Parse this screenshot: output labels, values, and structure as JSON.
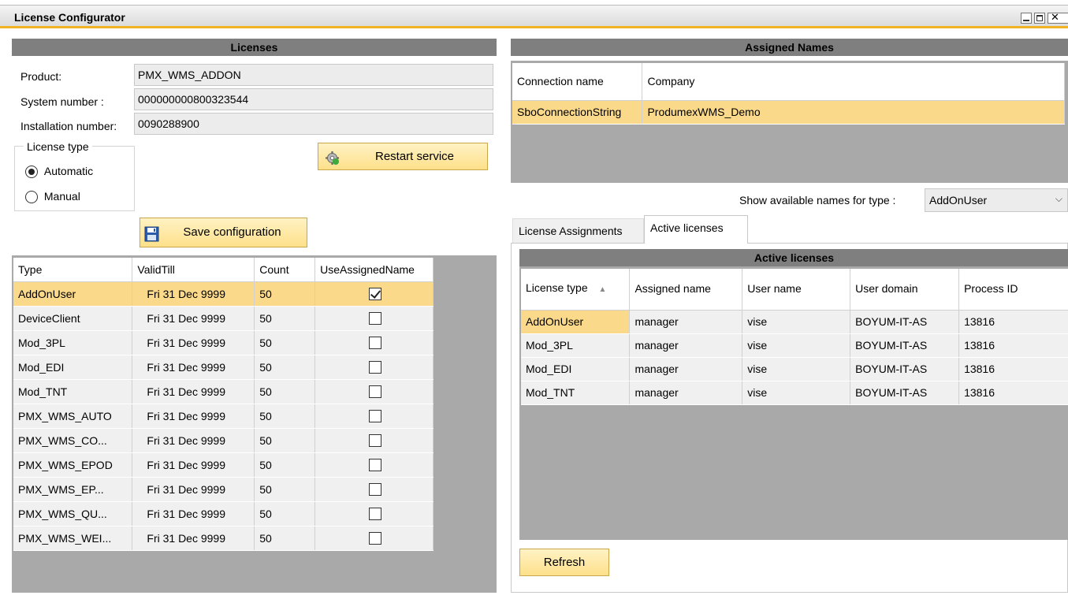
{
  "window": {
    "title": "License Configurator"
  },
  "licenses": {
    "header": "Licenses",
    "product_label": "Product:",
    "product_value": "PMX_WMS_ADDON",
    "system_number_label": "System number :",
    "system_number_value": "000000000800323544",
    "installation_number_label": "Installation number:",
    "installation_number_value": "0090288900",
    "license_type_legend": "License type",
    "license_type_options": [
      {
        "label": "Automatic",
        "selected": true
      },
      {
        "label": "Manual",
        "selected": false
      }
    ],
    "restart_service_label": "Restart service",
    "save_configuration_label": "Save configuration",
    "table": {
      "columns": [
        "Type",
        "ValidTill",
        "Count",
        "UseAssignedName"
      ],
      "rows": [
        {
          "type": "AddOnUser",
          "valid_till": "Fri 31 Dec 9999",
          "count": "50",
          "use_assigned_name": true,
          "selected": true
        },
        {
          "type": "DeviceClient",
          "valid_till": "Fri 31 Dec 9999",
          "count": "50",
          "use_assigned_name": false
        },
        {
          "type": "Mod_3PL",
          "valid_till": "Fri 31 Dec 9999",
          "count": "50",
          "use_assigned_name": false
        },
        {
          "type": "Mod_EDI",
          "valid_till": "Fri 31 Dec 9999",
          "count": "50",
          "use_assigned_name": false
        },
        {
          "type": "Mod_TNT",
          "valid_till": "Fri 31 Dec 9999",
          "count": "50",
          "use_assigned_name": false
        },
        {
          "type": "PMX_WMS_AUTO",
          "valid_till": "Fri 31 Dec 9999",
          "count": "50",
          "use_assigned_name": false
        },
        {
          "type": "PMX_WMS_CO...",
          "valid_till": "Fri 31 Dec 9999",
          "count": "50",
          "use_assigned_name": false
        },
        {
          "type": "PMX_WMS_EPOD",
          "valid_till": "Fri 31 Dec 9999",
          "count": "50",
          "use_assigned_name": false
        },
        {
          "type": "PMX_WMS_EP...",
          "valid_till": "Fri 31 Dec 9999",
          "count": "50",
          "use_assigned_name": false
        },
        {
          "type": "PMX_WMS_QU...",
          "valid_till": "Fri 31 Dec 9999",
          "count": "50",
          "use_assigned_name": false
        },
        {
          "type": "PMX_WMS_WEI...",
          "valid_till": "Fri 31 Dec 9999",
          "count": "50",
          "use_assigned_name": false
        }
      ]
    }
  },
  "assigned_names": {
    "header": "Assigned Names",
    "columns": [
      "Connection name",
      "Company"
    ],
    "rows": [
      {
        "connection_name": "SboConnectionString",
        "company": "ProdumexWMS_Demo",
        "selected": true
      }
    ],
    "show_names_label": "Show available names for type :",
    "show_names_value": "AddOnUser"
  },
  "tabs": [
    {
      "label": "License Assignments",
      "active": false
    },
    {
      "label": "Active licenses",
      "active": true
    }
  ],
  "active_licenses": {
    "header": "Active licenses",
    "columns": [
      "License type",
      "Assigned name",
      "User name",
      "User domain",
      "Process ID"
    ],
    "rows": [
      {
        "license_type": "AddOnUser",
        "assigned_name": "manager",
        "user_name": "vise",
        "user_domain": "BOYUM-IT-AS",
        "process_id": "13816"
      },
      {
        "license_type": "Mod_3PL",
        "assigned_name": "manager",
        "user_name": "vise",
        "user_domain": "BOYUM-IT-AS",
        "process_id": "13816"
      },
      {
        "license_type": "Mod_EDI",
        "assigned_name": "manager",
        "user_name": "vise",
        "user_domain": "BOYUM-IT-AS",
        "process_id": "13816"
      },
      {
        "license_type": "Mod_TNT",
        "assigned_name": "manager",
        "user_name": "vise",
        "user_domain": "BOYUM-IT-AS",
        "process_id": "13816"
      }
    ],
    "refresh_label": "Refresh"
  },
  "colors": {
    "accent": "#f0b323",
    "selection": "#fbd98a",
    "header_bar": "#7f7f7f",
    "empty_area": "#a9a9a9"
  }
}
